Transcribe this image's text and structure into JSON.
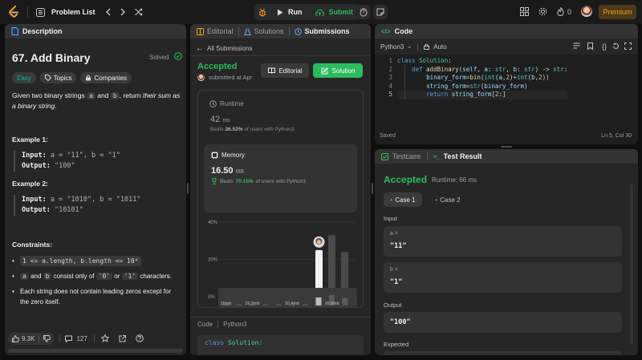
{
  "topbar": {
    "problem_list": "Problem List",
    "run": "Run",
    "submit": "Submit",
    "fire_count": "0",
    "premium": "Premium"
  },
  "desc": {
    "tab": "Description",
    "title": "67. Add Binary",
    "solved": "Solved",
    "difficulty": "Easy",
    "topics": "Topics",
    "companies": "Companies",
    "p1": "Given two binary strings",
    "a": "a",
    "and": "and",
    "b": "b",
    "p2": ", return",
    "p3": "their sum as a binary string",
    "p4": ".",
    "ex1_title": "Example 1:",
    "ex1_input_label": "Input:",
    "ex1_input": "a = \"11\", b = \"1\"",
    "ex1_output_label": "Output:",
    "ex1_output": "\"100\"",
    "ex2_title": "Example 2:",
    "ex2_input_label": "Input:",
    "ex2_input": "a = \"1010\", b = \"1011\"",
    "ex2_output_label": "Output:",
    "ex2_output": "\"10101\"",
    "constraints_title": "Constraints:",
    "c1": "1 <= a.length, b.length <= 10⁴",
    "c2_a": "a",
    "c2_and": "and",
    "c2_b": "b",
    "c2_text": "consist only of",
    "c2_zero": "'0'",
    "c2_or": "or",
    "c2_one": "'1'",
    "c2_end": "characters.",
    "c3": "Each string does not contain leading zeros except for the zero itself.",
    "likes": "9.3K",
    "comments": "127"
  },
  "submission": {
    "tab_editorial": "Editorial",
    "tab_solutions": "Solutions",
    "tab_submissions": "Submissions",
    "back": "All Submissions",
    "status": "Accepted",
    "submitted_at": "submitted at Apr",
    "editorial_btn": "Editorial",
    "solution_btn": "Solution",
    "runtime_label": "Runtime",
    "runtime_value": "42",
    "runtime_unit": "ms",
    "runtime_beats_pre": "Beats",
    "runtime_beats": "26.52%",
    "runtime_beats_post": "of users with Python3",
    "memory_label": "Memory",
    "memory_value": "16.50",
    "memory_unit": "MB",
    "memory_beats_pre": "Beats",
    "memory_beats": "70.15%",
    "memory_beats_post": "of users with Python3",
    "code_label": "Code",
    "code_lang": "Python3",
    "code_preview_kw": "class",
    "code_preview_cls": "Solution:"
  },
  "chart_data": {
    "type": "bar",
    "y_ticks": [
      "40%",
      "20%",
      "0%"
    ],
    "ylim": [
      0,
      40
    ],
    "x_tick_labels": [
      "16mb",
      "16.2mb",
      "16.4mb",
      "16.6mb"
    ],
    "values": [
      1,
      1,
      1,
      1,
      1,
      1,
      3,
      25,
      33,
      24
    ],
    "highlight_index": 7,
    "mini_labels": [
      "16mb",
      "16.2mb",
      "16.4mb",
      "16.6mb"
    ]
  },
  "code": {
    "tab": "Code",
    "lang": "Python3",
    "auto": "Auto",
    "saved": "Saved",
    "cursor": "Ln 5, Col 30",
    "line_numbers": [
      "1",
      "2",
      "3",
      "4",
      "5"
    ]
  },
  "result": {
    "tab_testcase": "Testcase",
    "tab_result": "Test Result",
    "status": "Accepted",
    "runtime": "Runtime: 66 ms",
    "case1": "Case 1",
    "case2": "Case 2",
    "input_label": "Input",
    "a_label": "a =",
    "a_value": "\"11\"",
    "b_label": "b =",
    "b_value": "\"1\"",
    "output_label": "Output",
    "output_value": "\"100\"",
    "expected_label": "Expected"
  },
  "colors": {
    "accent_green": "#2cbb5d",
    "accent_orange": "#ffa116",
    "easy_teal": "#00b8a3",
    "link_blue": "#0a84ff"
  }
}
